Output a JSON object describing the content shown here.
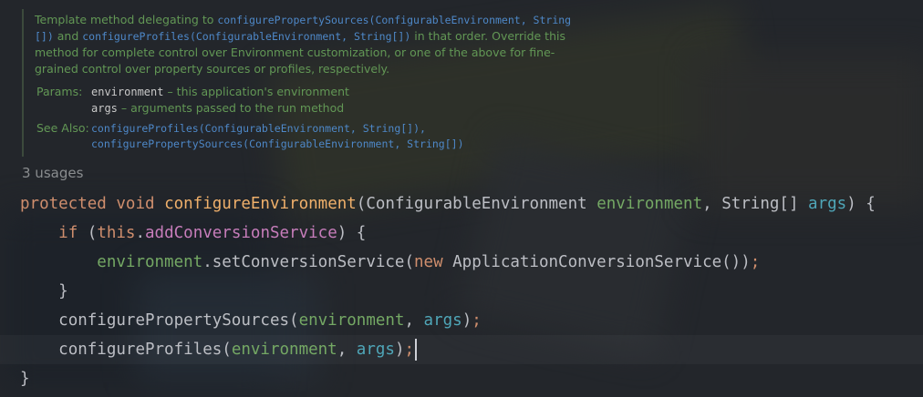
{
  "doc": {
    "text_1": "Template method delegating to ",
    "link_1": "configurePropertySources(ConfigurableEnvironment, String",
    "link_1b": "[])",
    "text_2": " and ",
    "link_2": "configureProfiles(ConfigurableEnvironment, String[])",
    "text_3": " in that order. Override this",
    "text_4": "method for complete control over Environment customization, or one of the above for fine-",
    "text_5": "grained control over property sources or profiles, respectively.",
    "params_label": "Params:",
    "params": [
      {
        "name": "environment",
        "desc": " – this application's environment"
      },
      {
        "name": "args",
        "desc": " – arguments passed to the run method"
      }
    ],
    "see_also_label": "See Also:",
    "see_also": [
      "configureProfiles(ConfigurableEnvironment, String[]),",
      "configurePropertySources(ConfigurableEnvironment, String[])"
    ]
  },
  "usages": "3 usages",
  "code": {
    "l1": {
      "kw_protected": "protected",
      "kw_void": "void",
      "method": "configureEnvironment",
      "open": "(",
      "type1": "ConfigurableEnvironment",
      "p1": "environment",
      "comma": ", ",
      "type2": "String[]",
      "p2": "args",
      "close": ") {"
    },
    "l2": {
      "kw_if": "if",
      "open": " (",
      "this": "this",
      "dot": ".",
      "field": "addConversionService",
      "close": ") {"
    },
    "l3": {
      "p1": "environment",
      "call": ".setConversionService(",
      "kw_new": "new",
      "cls": " ApplicationConversionService())",
      "semi": ";"
    },
    "l4": {
      "brace": "}"
    },
    "l5": {
      "method": "configurePropertySources(",
      "p1": "environment",
      "comma": ", ",
      "p2": "args",
      "close": ")",
      "semi": ";"
    },
    "l6": {
      "method": "configureProfiles(",
      "p1": "environment",
      "comma": ", ",
      "p2": "args",
      "close": ")",
      "semi": ";"
    },
    "l7": {
      "brace": "}"
    }
  }
}
